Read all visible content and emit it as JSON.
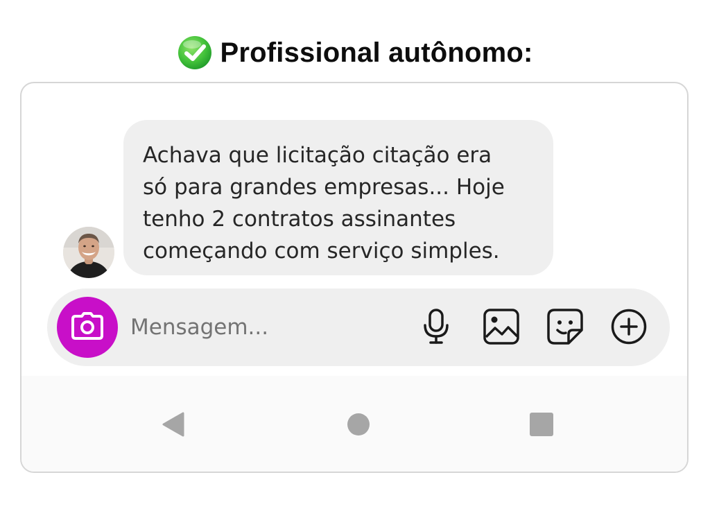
{
  "heading": {
    "icon": "check-mark-icon",
    "text": "Profissional autônomo:"
  },
  "chat": {
    "avatar_icon": "user-avatar",
    "message": "Achava que licitação citação era\nsó para grandes empresas... Hoje\ntenho 2 contratos assinantes\ncomeçando com serviço simples."
  },
  "composer": {
    "placeholder": "Mensagem...",
    "value": "",
    "camera_icon": "camera-icon",
    "icons": [
      "microphone-icon",
      "gallery-icon",
      "sticker-icon",
      "plus-circle-icon"
    ]
  },
  "navbar": {
    "icons": [
      "back-triangle-icon",
      "home-circle-icon",
      "recents-square-icon"
    ]
  },
  "colors": {
    "camera_accent": "#c80fc8",
    "check_green": "#3fbf3f",
    "bubble_bg": "#efefef",
    "text": "#262626"
  }
}
